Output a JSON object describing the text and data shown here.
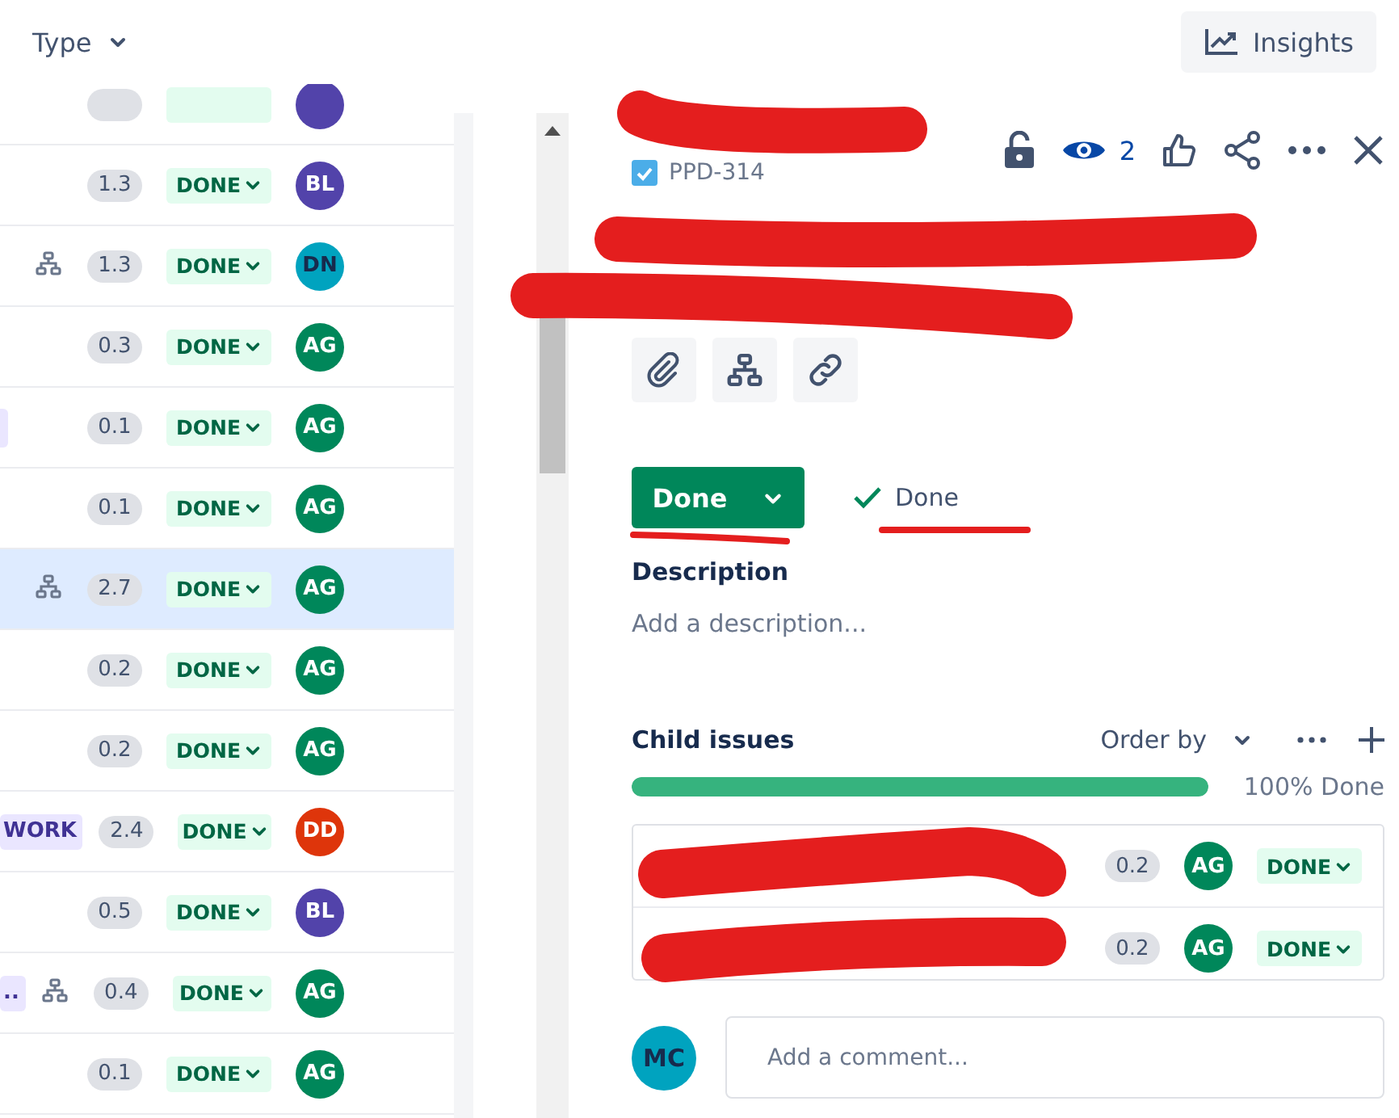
{
  "toolbar": {
    "filter": "Type",
    "insights": "Insights"
  },
  "issues": [
    {
      "kind": "cut",
      "color": "#5243aa",
      "selected": false
    },
    {
      "kind": "row",
      "estimate": "1.3",
      "status": "DONE",
      "assignee": "BL",
      "color": "#5243aa",
      "has_children": false,
      "tag_stub": false,
      "selected": false
    },
    {
      "kind": "row",
      "estimate": "1.3",
      "status": "DONE",
      "assignee": "DN",
      "color": "#00a3bf",
      "has_children": true,
      "tag_stub": false,
      "selected": false
    },
    {
      "kind": "row",
      "estimate": "0.3",
      "status": "DONE",
      "assignee": "AG",
      "color": "#00875a",
      "has_children": false,
      "tag_stub": false,
      "selected": false
    },
    {
      "kind": "row",
      "estimate": "0.1",
      "status": "DONE",
      "assignee": "AG",
      "color": "#00875a",
      "has_children": false,
      "tag_stub": true,
      "selected": false
    },
    {
      "kind": "row",
      "estimate": "0.1",
      "status": "DONE",
      "assignee": "AG",
      "color": "#00875a",
      "has_children": false,
      "tag_stub": false,
      "selected": false
    },
    {
      "kind": "row",
      "estimate": "2.7",
      "status": "DONE",
      "assignee": "AG",
      "color": "#00875a",
      "has_children": true,
      "tag_stub": false,
      "selected": true
    },
    {
      "kind": "row",
      "estimate": "0.2",
      "status": "DONE",
      "assignee": "AG",
      "color": "#00875a",
      "has_children": false,
      "tag_stub": false,
      "selected": false
    },
    {
      "kind": "row",
      "estimate": "0.2",
      "status": "DONE",
      "assignee": "AG",
      "color": "#00875a",
      "has_children": false,
      "tag_stub": false,
      "selected": false
    },
    {
      "kind": "row",
      "tag": "WORK",
      "estimate": "2.4",
      "status": "DONE",
      "assignee": "DD",
      "color": "#de350b",
      "has_children": false,
      "tag_stub": false,
      "selected": false
    },
    {
      "kind": "row",
      "estimate": "0.5",
      "status": "DONE",
      "assignee": "BL",
      "color": "#5243aa",
      "has_children": false,
      "tag_stub": false,
      "selected": false
    },
    {
      "kind": "row",
      "tag": "..",
      "estimate": "0.4",
      "status": "DONE",
      "assignee": "AG",
      "color": "#00875a",
      "has_children": true,
      "tag_stub": false,
      "selected": false
    },
    {
      "kind": "row",
      "estimate": "0.1",
      "status": "DONE",
      "assignee": "AG",
      "color": "#00875a",
      "has_children": false,
      "tag_stub": false,
      "selected": false
    }
  ],
  "detail": {
    "key": "PPD-314",
    "watchers": "2",
    "status_button": "Done",
    "resolution": "Done",
    "description_label": "Description",
    "description_placeholder": "Add a description...",
    "child_issues": {
      "title": "Child issues",
      "order_by": "Order by",
      "progress": {
        "level": 1,
        "label": "100% Done"
      },
      "rows": [
        {
          "estimate": "0.2",
          "assignee": "AG",
          "color": "#00875a",
          "status": "DONE"
        },
        {
          "estimate": "0.2",
          "assignee": "AG",
          "color": "#00875a",
          "status": "DONE"
        }
      ]
    },
    "comment": {
      "avatar": "MC",
      "color": "#00a3bf",
      "placeholder": "Add a comment..."
    }
  }
}
